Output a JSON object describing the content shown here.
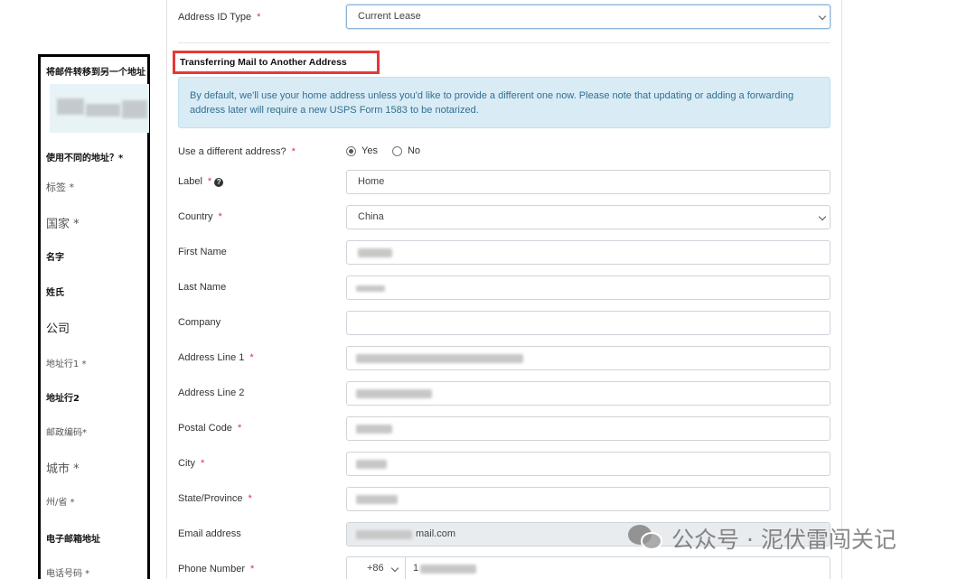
{
  "annotation_column": {
    "title": "将邮件转移到另一个地址",
    "labels": [
      {
        "text": "使用不同的地址？*",
        "size": 10,
        "bold": true,
        "color": "#111"
      },
      {
        "text": "标签 *",
        "size": 11,
        "bold": false,
        "color": "#555"
      },
      {
        "text": "国家 *",
        "size": 13,
        "bold": false,
        "color": "#555"
      },
      {
        "text": "名字",
        "size": 10,
        "bold": true,
        "color": "#111"
      },
      {
        "text": "姓氏",
        "size": 10,
        "bold": true,
        "color": "#111"
      },
      {
        "text": "公司",
        "size": 13,
        "bold": false,
        "color": "#222"
      },
      {
        "text": "地址行1 *",
        "size": 10,
        "bold": false,
        "color": "#555"
      },
      {
        "text": "地址行2",
        "size": 10,
        "bold": true,
        "color": "#111"
      },
      {
        "text": "邮政编码*",
        "size": 10,
        "bold": false,
        "color": "#555"
      },
      {
        "text": "城市 *",
        "size": 13,
        "bold": false,
        "color": "#555"
      },
      {
        "text": "州/省 *",
        "size": 10,
        "bold": false,
        "color": "#555"
      },
      {
        "text": "电子邮箱地址",
        "size": 10,
        "bold": true,
        "color": "#111"
      },
      {
        "text": "电话号码 *",
        "size": 10,
        "bold": false,
        "color": "#555"
      }
    ]
  },
  "form": {
    "address_id_type": {
      "label": "Address ID Type",
      "value": "Current Lease"
    },
    "section_title": "Transferring Mail to Another Address",
    "info_text": "By default, we'll use your home address unless you'd like to provide a different one now. Please note that updating or adding a forwarding address later will require a new USPS Form 1583 to be notarized.",
    "use_different": {
      "label": "Use a different address?",
      "yes": "Yes",
      "no": "No",
      "selected": "Yes"
    },
    "label_field": {
      "label": "Label",
      "value": "Home"
    },
    "country": {
      "label": "Country",
      "value": "China"
    },
    "first_name": {
      "label": "First Name"
    },
    "last_name": {
      "label": "Last Name"
    },
    "company": {
      "label": "Company"
    },
    "address_line_1": {
      "label": "Address Line 1"
    },
    "address_line_2": {
      "label": "Address Line 2"
    },
    "postal_code": {
      "label": "Postal Code"
    },
    "city": {
      "label": "City"
    },
    "state_province": {
      "label": "State/Province"
    },
    "email": {
      "label": "Email address",
      "visible_value": "mail.com"
    },
    "phone": {
      "label": "Phone Number",
      "prefix": "+86",
      "visible_value": "1"
    }
  },
  "required_mark": "*",
  "help_icon_glyph": "?",
  "watermark": {
    "text": "公众号 · 泥伏雷闯关记"
  },
  "colors": {
    "required": "#dc3545",
    "highlight_border": "#e53935",
    "info_bg": "#d9ecf6",
    "info_text": "#31708f"
  }
}
